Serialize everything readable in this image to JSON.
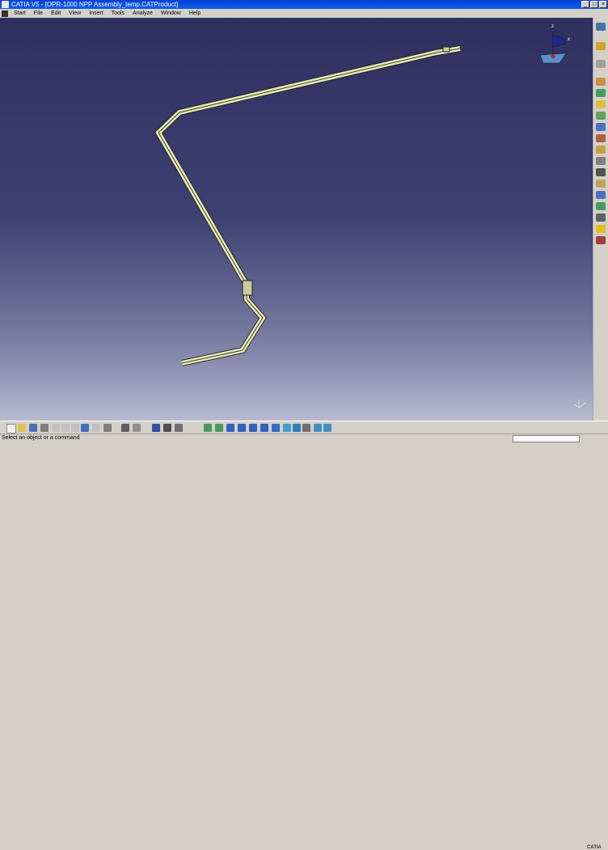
{
  "window": {
    "title": "CATIA V5 - [OPR-1000 NPP Assembly_temp.CATProduct]"
  },
  "menu": [
    "Start",
    "File",
    "Edit",
    "View",
    "Insert",
    "Tools",
    "Analyze",
    "Window",
    "Help"
  ],
  "status": {
    "message": "Select an object or a command"
  },
  "compass": {
    "axis_z": "z",
    "axis_x": "x"
  },
  "brand": "CATIA",
  "colors": {
    "pipe": "#e8ecb8",
    "pipe_edge": "#2a2a22",
    "bg_top": "#303060",
    "bg_bottom": "#b8bad0"
  }
}
